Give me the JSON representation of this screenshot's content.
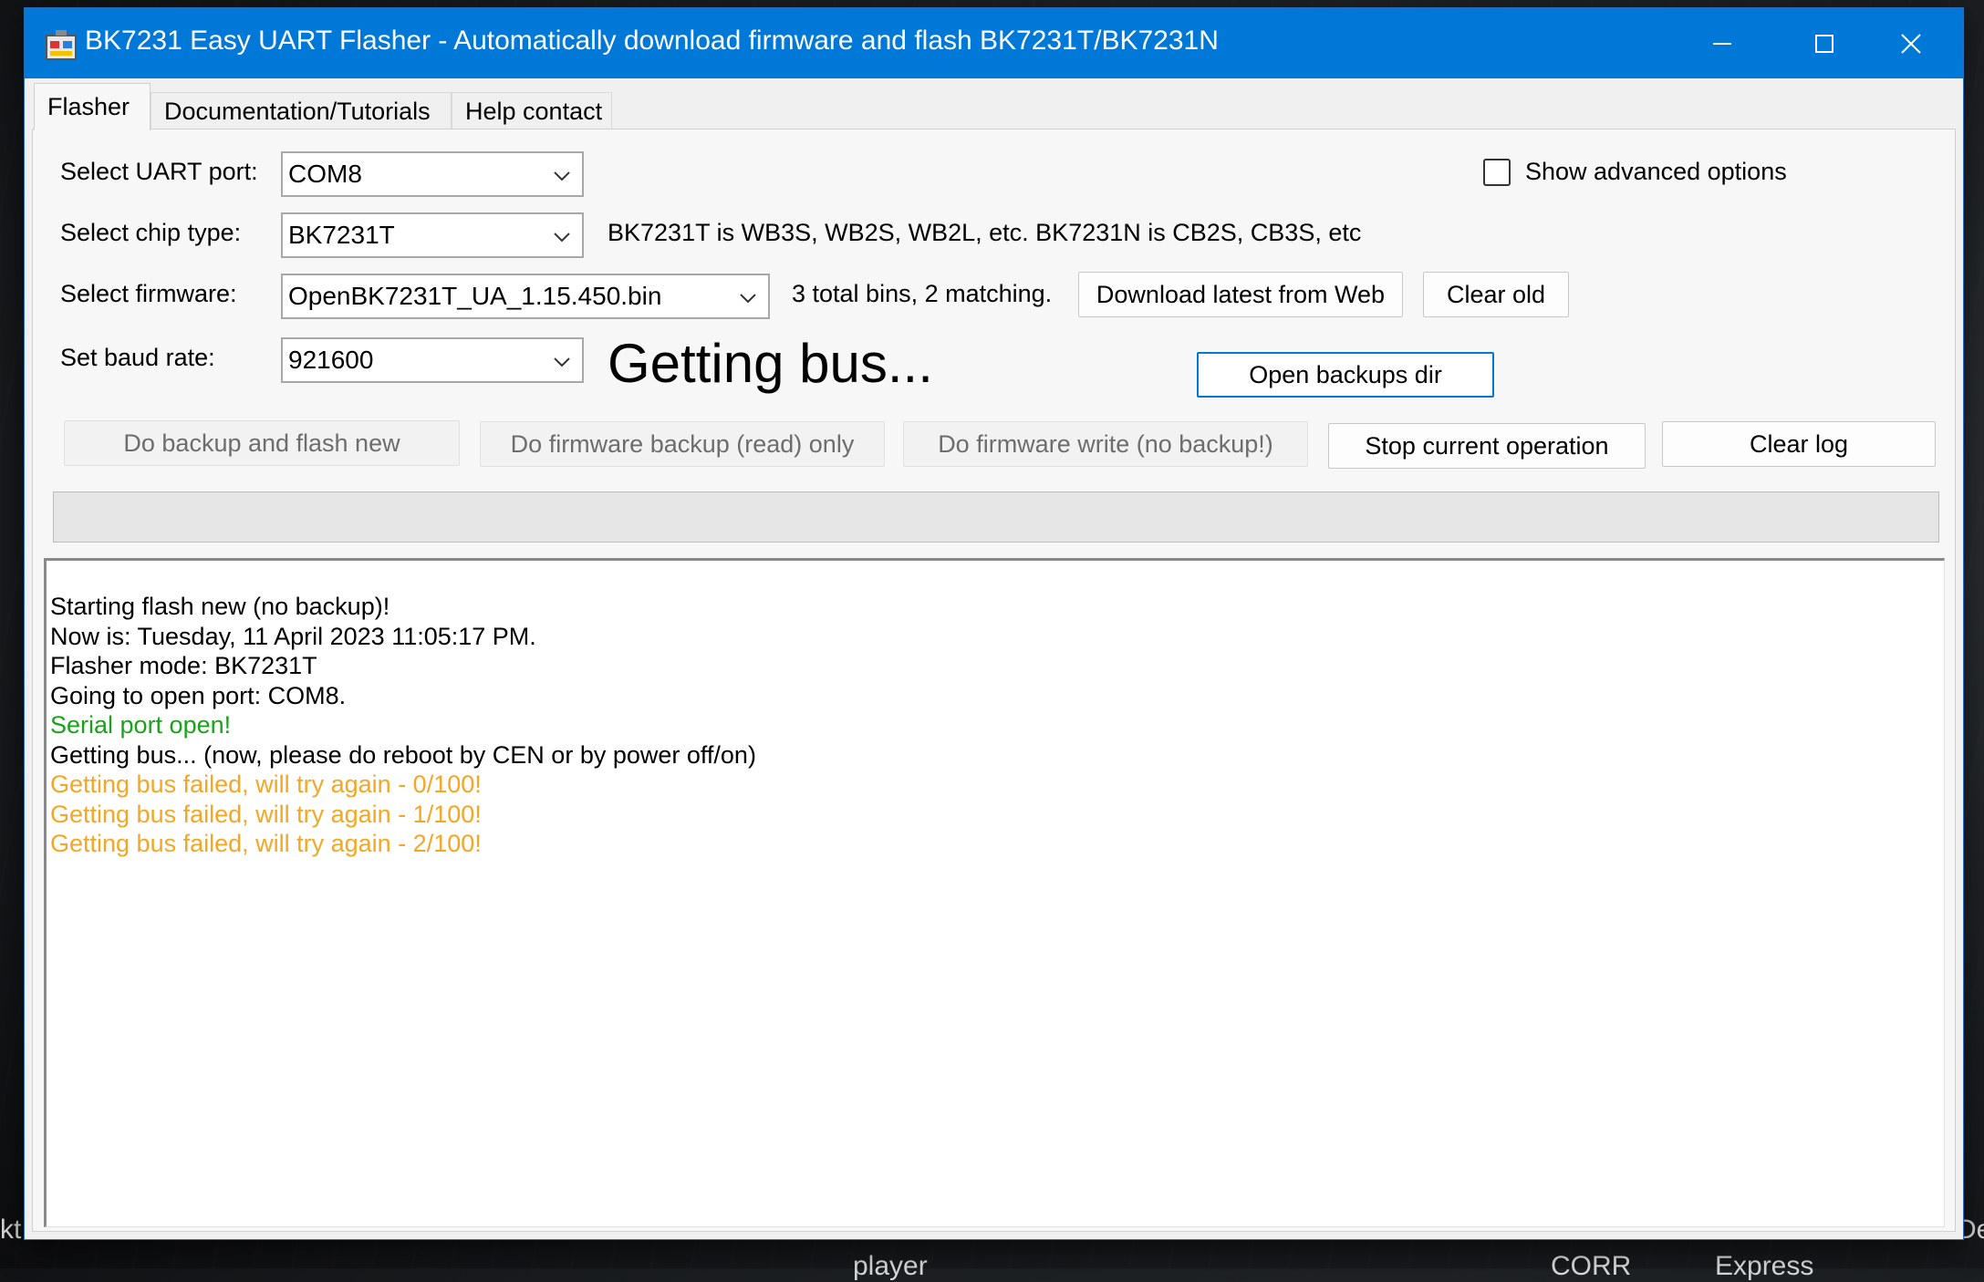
{
  "window": {
    "title": "BK7231 Easy UART Flasher - Automatically download firmware and flash BK7231T/BK7231N",
    "controls": {
      "minimize": "minimize-icon",
      "maximize": "maximize-icon",
      "close": "close-icon"
    }
  },
  "tabs": [
    {
      "label": "Flasher",
      "active": true
    },
    {
      "label": "Documentation/Tutorials",
      "active": false
    },
    {
      "label": "Help contact",
      "active": false
    }
  ],
  "form": {
    "uart_label": "Select UART port:",
    "uart_value": "COM8",
    "chip_label": "Select chip type:",
    "chip_value": "BK7231T",
    "chip_info": "BK7231T is WB3S, WB2S, WB2L, etc. BK7231N is CB2S, CB3S, etc",
    "firmware_label": "Select firmware:",
    "firmware_value": "OpenBK7231T_UA_1.15.450.bin",
    "firmware_info": "3 total bins, 2 matching.",
    "baud_label": "Set baud rate:",
    "baud_value": "921600",
    "advanced_label": "Show advanced options",
    "advanced_checked": false
  },
  "status_text": "Getting bus...",
  "buttons": {
    "download_latest": "Download latest from Web",
    "clear_old": "Clear old",
    "open_backups": "Open backups dir",
    "backup_and_flash": "Do backup and flash new",
    "backup_only": "Do firmware backup (read) only",
    "write_only": "Do firmware write (no backup!)",
    "stop": "Stop current operation",
    "clear_log": "Clear log"
  },
  "progress": {
    "value": 0
  },
  "log": [
    {
      "text": "Starting flash new (no backup)!",
      "color": "#000000"
    },
    {
      "text": "Now is: Tuesday, 11 April 2023 11:05:17 PM.",
      "color": "#000000"
    },
    {
      "text": "Flasher mode: BK7231T",
      "color": "#000000"
    },
    {
      "text": "Going to open port: COM8.",
      "color": "#000000"
    },
    {
      "text": "Serial port open!",
      "color": "#1aa31a"
    },
    {
      "text": "Getting bus... (now, please do reboot by CEN or by power off/on)",
      "color": "#000000"
    },
    {
      "text": "Getting bus failed, will try again - 0/100!",
      "color": "#f5a623"
    },
    {
      "text": "Getting bus failed, will try again - 1/100!",
      "color": "#f5a623"
    },
    {
      "text": "Getting bus failed, will try again - 2/100!",
      "color": "#f5a623"
    }
  ],
  "desktop_labels": [
    "kt",
    "player",
    "CORR",
    "Express",
    "De"
  ],
  "colors": {
    "titlebar": "#0078d7",
    "accent": "#0078d7"
  }
}
